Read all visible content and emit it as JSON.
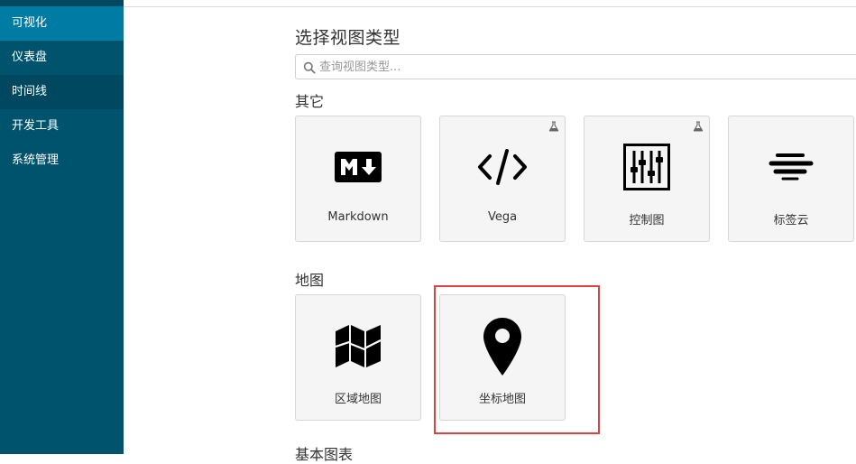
{
  "sidebar": {
    "items": [
      {
        "label": "可视化",
        "state": "active"
      },
      {
        "label": "仪表盘",
        "state": "normal"
      },
      {
        "label": "时间线",
        "state": "hover"
      },
      {
        "label": "开发工具",
        "state": "normal"
      },
      {
        "label": "系统管理",
        "state": "normal"
      }
    ]
  },
  "main": {
    "title": "选择视图类型",
    "search": {
      "placeholder": "查询视图类型...",
      "value": ""
    },
    "sections": [
      {
        "title": "其它",
        "cards": [
          {
            "label": "Markdown",
            "icon": "markdown-icon",
            "beta": false
          },
          {
            "label": "Vega",
            "icon": "code-icon",
            "beta": true
          },
          {
            "label": "控制图",
            "icon": "sliders-icon",
            "beta": true
          },
          {
            "label": "标签云",
            "icon": "tag-cloud-icon",
            "beta": false
          }
        ]
      },
      {
        "title": "地图",
        "cards": [
          {
            "label": "区域地图",
            "icon": "map-icon",
            "beta": false
          },
          {
            "label": "坐标地图",
            "icon": "map-marker-icon",
            "beta": false,
            "highlighted": true
          }
        ]
      },
      {
        "title": "基本图表"
      }
    ]
  },
  "colors": {
    "sidebar_bg": "#00536d",
    "sidebar_active": "#007ca4",
    "sidebar_hover": "#004860",
    "highlight_border": "#e0403f",
    "card_bg": "#f5f5f5"
  }
}
